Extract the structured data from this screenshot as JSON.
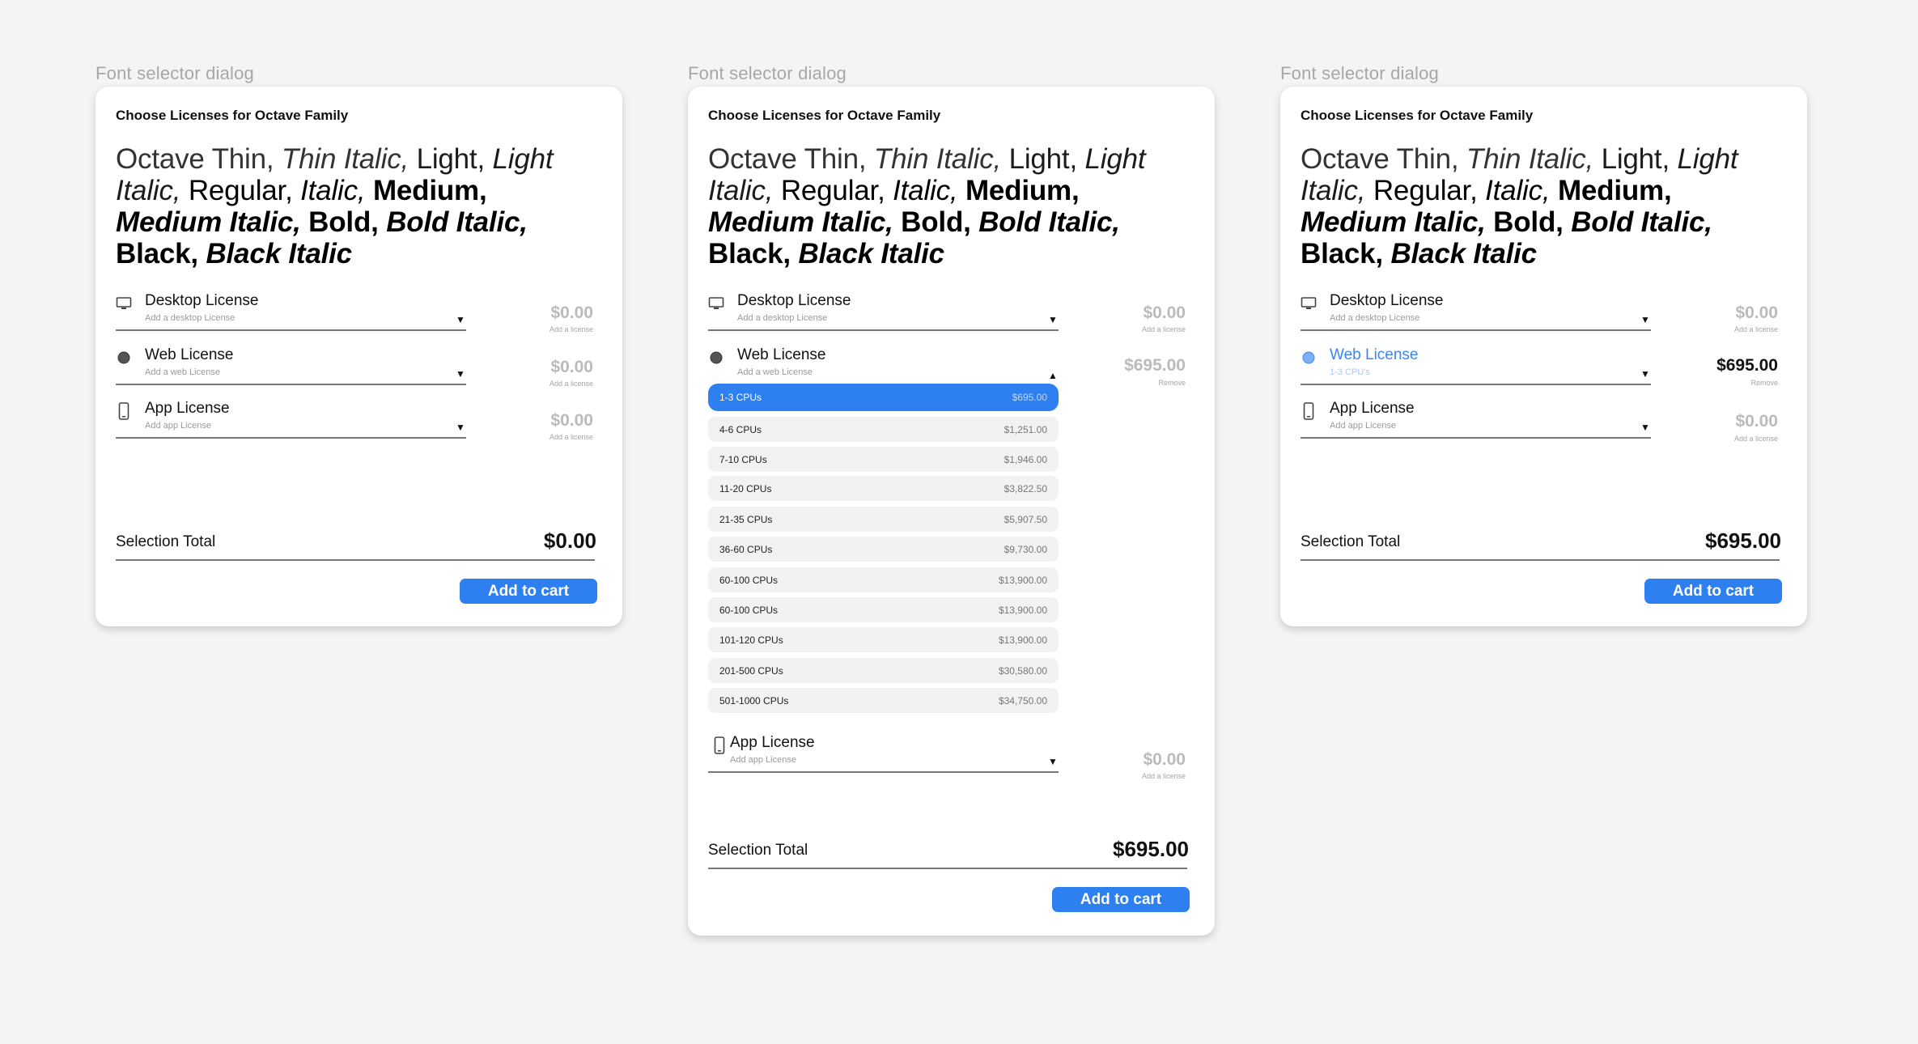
{
  "colors": {
    "accent": "#2e80f0",
    "link_blue": "#3c86f2",
    "muted_price": "#bbbbbb"
  },
  "frames": [
    {
      "label": "Font selector dialog",
      "title": "Choose Licenses for Octave Family",
      "specimen": {
        "thin": "Octave Thin,",
        "thin_italic": "Thin Italic,",
        "light": "Light,",
        "light_italic": "Light Italic,",
        "regular": "Regular,",
        "italic": "Italic,",
        "medium": "Medium,",
        "medium_italic": "Medium Italic,",
        "bold": "Bold,",
        "bold_italic": "Bold Italic,",
        "black": "Black,",
        "black_italic": "Black Italic"
      },
      "desktop": {
        "name": "Desktop License",
        "hint": "Add a desktop License",
        "price": "$0.00",
        "sub": "Add a license",
        "icon": "monitor-icon"
      },
      "web": {
        "name": "Web License",
        "hint": "Add a web License",
        "price": "$0.00",
        "sub": "Add a license",
        "icon": "globe-icon"
      },
      "app": {
        "name": "App License",
        "hint": "Add app License",
        "price": "$0.00",
        "sub": "Add a license",
        "icon": "phone-icon"
      },
      "total_label": "Selection Total",
      "total_value": "$0.00",
      "button": "Add to cart"
    },
    {
      "label": "Font selector dialog",
      "title": "Choose Licenses for Octave Family",
      "specimen": {
        "thin": "Octave Thin,",
        "thin_italic": "Thin Italic,",
        "light": "Light,",
        "light_italic": "Light Italic,",
        "regular": "Regular,",
        "italic": "Italic,",
        "medium": "Medium,",
        "medium_italic": "Medium Italic,",
        "bold": "Bold,",
        "bold_italic": "Bold Italic,",
        "black": "Black,",
        "black_italic": "Black Italic"
      },
      "desktop": {
        "name": "Desktop License",
        "hint": "Add a desktop License",
        "price": "$0.00",
        "sub": "Add a license"
      },
      "web": {
        "name": "Web License",
        "hint": "Add a web License",
        "price": "$695.00",
        "sub": "Remove"
      },
      "options": [
        {
          "label": "1-3 CPUs",
          "price": "$695.00",
          "selected": true
        },
        {
          "label": "4-6 CPUs",
          "price": "$1,251.00"
        },
        {
          "label": "7-10 CPUs",
          "price": "$1,946.00"
        },
        {
          "label": "11-20 CPUs",
          "price": "$3,822.50"
        },
        {
          "label": "21-35 CPUs",
          "price": "$5,907.50"
        },
        {
          "label": "36-60 CPUs",
          "price": "$9,730.00"
        },
        {
          "label": "60-100 CPUs",
          "price": "$13,900.00"
        },
        {
          "label": "60-100 CPUs",
          "price": "$13,900.00"
        },
        {
          "label": "101-120 CPUs",
          "price": "$13,900.00"
        },
        {
          "label": "201-500 CPUs",
          "price": "$30,580.00"
        },
        {
          "label": "501-1000 CPUs",
          "price": "$34,750.00"
        }
      ],
      "app": {
        "name": "App License",
        "hint": "Add app License",
        "price": "$0.00",
        "sub": "Add a license"
      },
      "total_label": "Selection Total",
      "total_value": "$695.00",
      "button": "Add to cart"
    },
    {
      "label": "Font selector dialog",
      "title": "Choose Licenses for Octave Family",
      "specimen": {
        "thin": "Octave Thin,",
        "thin_italic": "Thin Italic,",
        "light": "Light,",
        "light_italic": "Light Italic,",
        "regular": "Regular,",
        "italic": "Italic,",
        "medium": "Medium,",
        "medium_italic": "Medium Italic,",
        "bold": "Bold,",
        "bold_italic": "Bold Italic,",
        "black": "Black,",
        "black_italic": "Black Italic"
      },
      "desktop": {
        "name": "Desktop License",
        "hint": "Add a desktop License",
        "price": "$0.00",
        "sub": "Add a license"
      },
      "web": {
        "name": "Web License",
        "hint": "1-3 CPU's",
        "price": "$695.00",
        "sub": "Remove"
      },
      "app": {
        "name": "App License",
        "hint": "Add app License",
        "price": "$0.00",
        "sub": "Add a license"
      },
      "total_label": "Selection Total",
      "total_value": "$695.00",
      "button": "Add to cart"
    }
  ]
}
